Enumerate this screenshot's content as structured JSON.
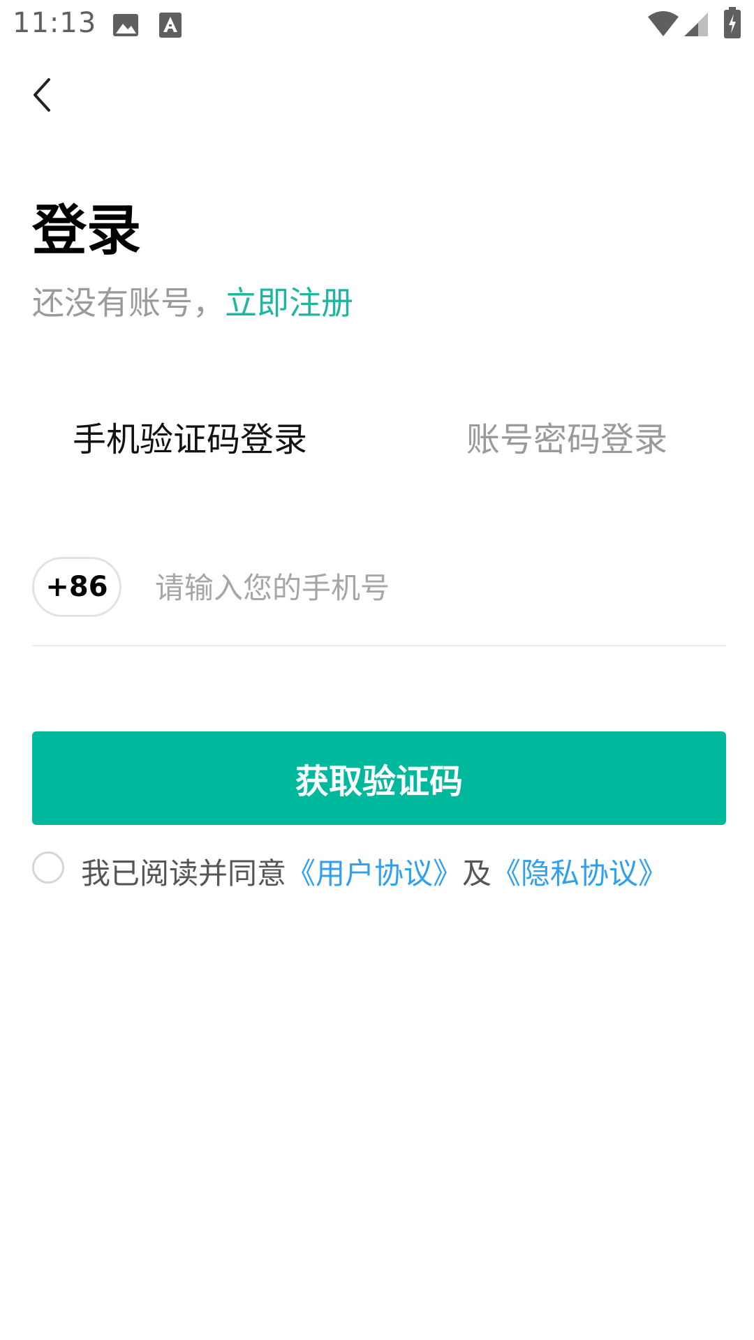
{
  "status_bar": {
    "time": "11:13",
    "icons": [
      "image-icon",
      "font-icon",
      "wifi-icon",
      "signal-icon",
      "battery-charging-icon"
    ]
  },
  "header": {
    "back_icon": "chevron-left-icon"
  },
  "page": {
    "title": "登录",
    "no_account_text": "还没有账号，",
    "register_link": "立即注册"
  },
  "tabs": [
    {
      "label": "手机验证码登录",
      "active": true
    },
    {
      "label": "账号密码登录",
      "active": false
    }
  ],
  "phone": {
    "country_code": "+86",
    "placeholder": "请输入您的手机号",
    "value": ""
  },
  "actions": {
    "get_code_label": "获取验证码"
  },
  "agreement": {
    "checked": false,
    "prefix": "我已阅读并同意",
    "user_agreement": "《用户协议》",
    "and": "及",
    "privacy_agreement": "《隐私协议》"
  },
  "colors": {
    "accent": "#00b89c",
    "link_green": "#1fb5a0",
    "link_blue": "#2f9ff0"
  }
}
